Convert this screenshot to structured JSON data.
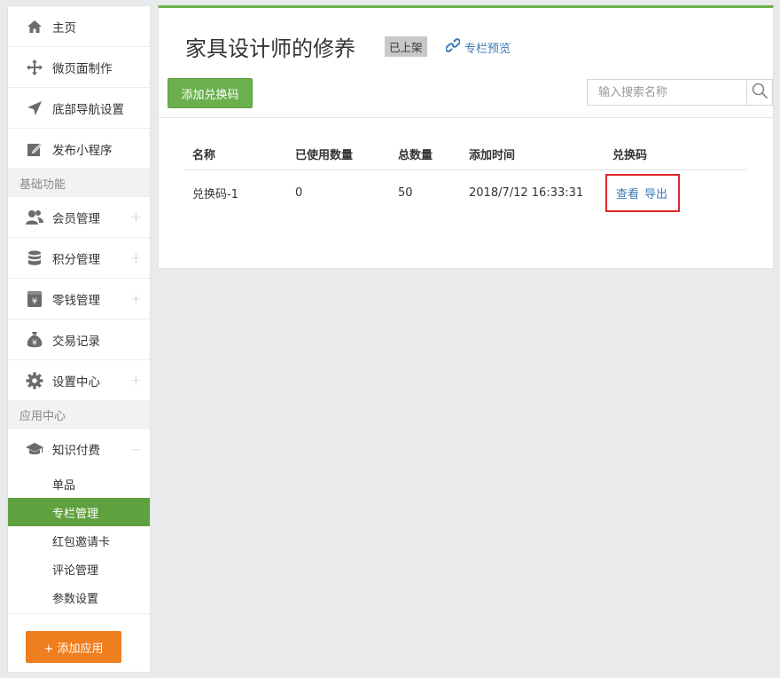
{
  "sidebar": {
    "items": [
      {
        "label": "主页",
        "icon": "home-icon",
        "expandable": false
      },
      {
        "label": "微页面制作",
        "icon": "move-icon",
        "expandable": false
      },
      {
        "label": "底部导航设置",
        "icon": "navigation-arrow-icon",
        "expandable": false
      },
      {
        "label": "发布小程序",
        "icon": "edit-icon",
        "expandable": false
      }
    ],
    "section_basic": "基础功能",
    "basic_items": [
      {
        "label": "会员管理",
        "icon": "users-icon",
        "expand_symbol": "+"
      },
      {
        "label": "积分管理",
        "icon": "database-icon",
        "expand_symbol": "+"
      },
      {
        "label": "零钱管理",
        "icon": "wallet-yen-icon",
        "expand_symbol": "+"
      },
      {
        "label": "交易记录",
        "icon": "money-bag-icon",
        "expand_symbol": ""
      },
      {
        "label": "设置中心",
        "icon": "gear-icon",
        "expand_symbol": "+"
      }
    ],
    "section_apps": "应用中心",
    "knowledge": {
      "label": "知识付费",
      "icon": "graduation-cap-icon",
      "expand_symbol": "−"
    },
    "sub_items": [
      {
        "label": "单品",
        "active": false
      },
      {
        "label": "专栏管理",
        "active": true
      },
      {
        "label": "红包邀请卡",
        "active": false
      },
      {
        "label": "评论管理",
        "active": false
      },
      {
        "label": "参数设置",
        "active": false
      }
    ],
    "add_app_label": "+ 添加应用"
  },
  "main": {
    "title": "家具设计师的修养",
    "status_badge": "已上架",
    "preview_label": "专栏预览",
    "add_code_label": "添加兑换码",
    "search_placeholder": "输入搜索名称",
    "table": {
      "headers": [
        "名称",
        "已使用数量",
        "总数量",
        "添加时间",
        "兑换码"
      ],
      "rows": [
        {
          "name": "兑换码-1",
          "used": "0",
          "total": "50",
          "added": "2018/7/12 16:33:31",
          "view_label": "查看",
          "export_label": "导出"
        }
      ]
    }
  },
  "colors": {
    "accent_green": "#6ab04c",
    "active_green": "#5fa13e",
    "orange": "#ef7e1e",
    "link_blue": "#3e78b3",
    "highlight_red": "#e0252a"
  }
}
